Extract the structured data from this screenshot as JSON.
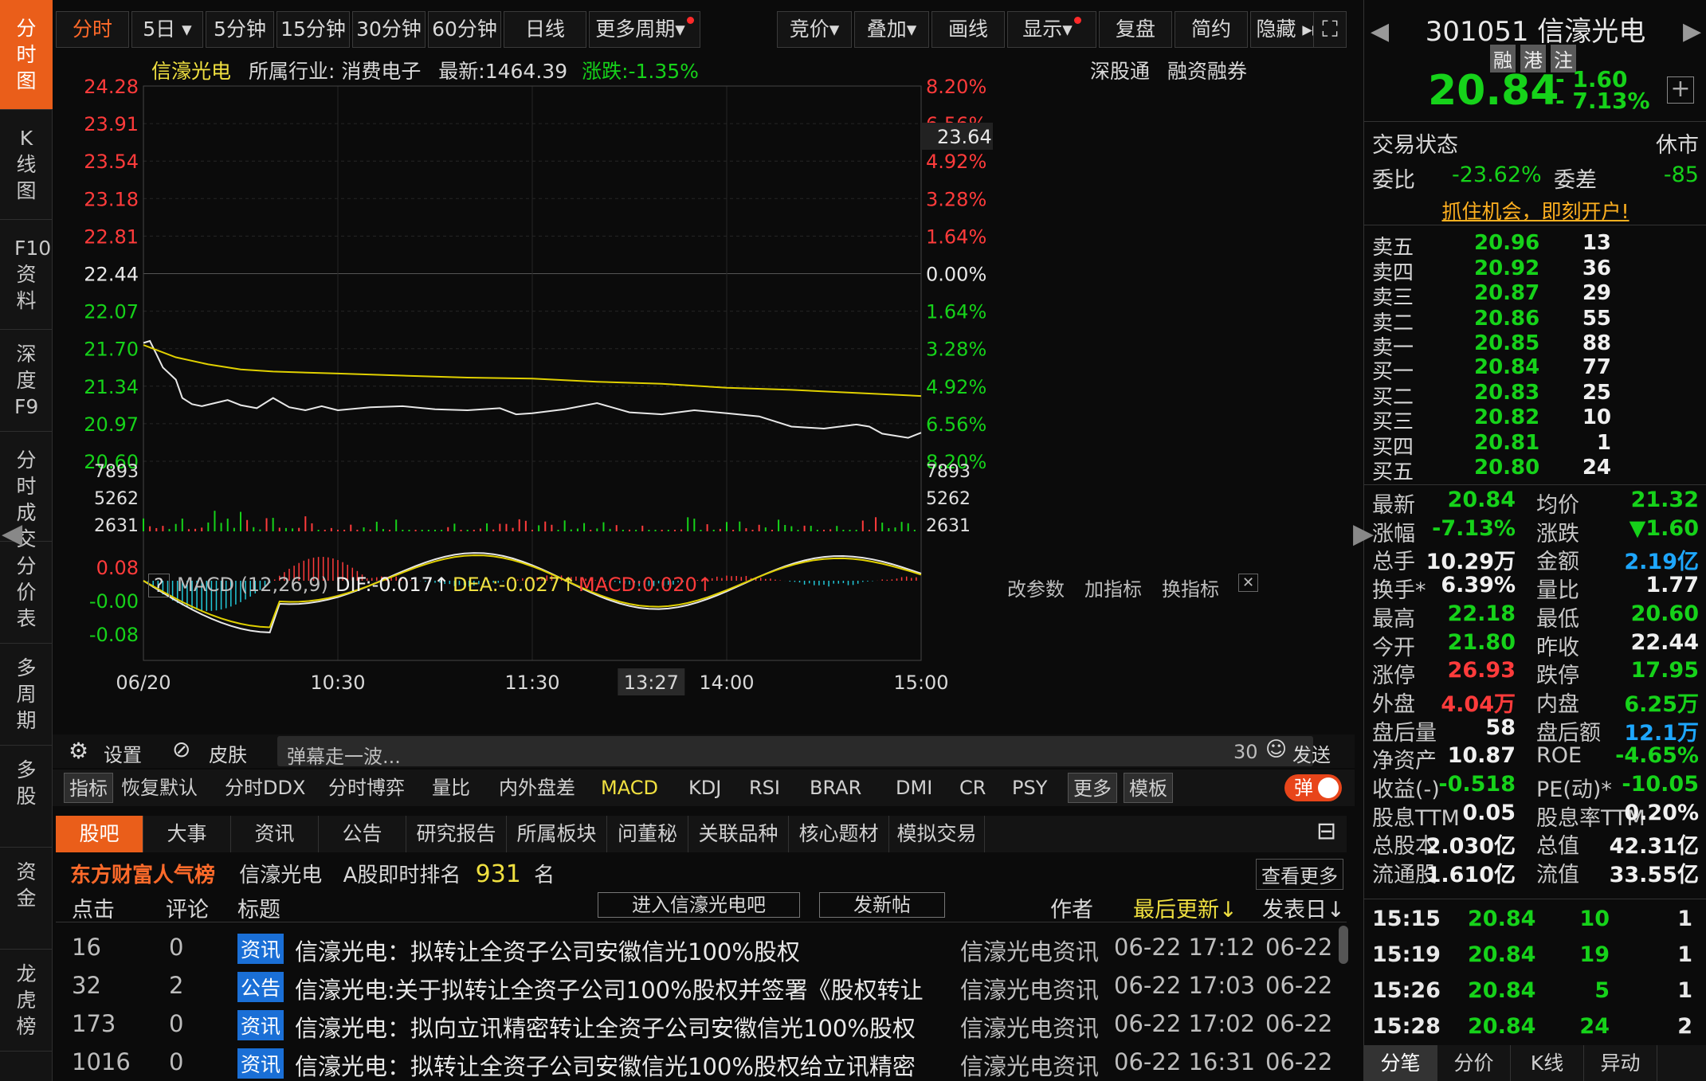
{
  "left_nav": [
    {
      "label": "分时图",
      "active": true
    },
    {
      "label": "K线图"
    },
    {
      "label": "F10资料"
    },
    {
      "label": "深度F9"
    },
    {
      "label": "分时成交"
    },
    {
      "label": "分价表"
    },
    {
      "label": "多周期"
    },
    {
      "label": "多股"
    },
    {
      "label": "资金"
    },
    {
      "label": "龙虎榜"
    }
  ],
  "toolbar": {
    "tabs": [
      "分时",
      "5日",
      "5分钟",
      "15分钟",
      "30分钟",
      "60分钟",
      "日线",
      "更多周期"
    ],
    "right": [
      "竞价",
      "叠加",
      "画线",
      "显示",
      "复盘",
      "简约",
      "隐藏 ▸▸"
    ]
  },
  "info": {
    "name": "信濠光电",
    "industry": "所属行业: 消费电子",
    "latest": "最新:1464.39",
    "change": "涨跌:-1.35%",
    "links": [
      "深股通",
      "融资融券"
    ]
  },
  "chart_data": {
    "type": "line",
    "title": "",
    "x_ticks": [
      "06/20",
      "10:30",
      "11:30",
      "13:27",
      "14:00",
      "15:00"
    ],
    "price_ticks_left": [
      "24.28",
      "23.91",
      "23.54",
      "23.18",
      "22.81",
      "22.44",
      "22.07",
      "21.70",
      "21.34",
      "20.97",
      "20.60"
    ],
    "pct_ticks_right": [
      "8.20%",
      "6.56%",
      "4.92%",
      "3.28%",
      "1.64%",
      "0.00%",
      "1.64%",
      "3.28%",
      "4.92%",
      "6.56%",
      "8.20%"
    ],
    "crosshair_value": "23.64",
    "ylim": [
      20.6,
      24.28
    ],
    "series": [
      {
        "color": "#e8e8e8",
        "x": [
          0,
          2,
          4,
          6,
          8,
          10,
          12,
          15,
          18,
          22,
          26,
          30,
          35,
          40,
          45,
          50,
          55,
          60,
          70,
          80,
          90,
          100,
          110,
          115,
          120,
          130,
          140,
          150,
          160,
          170,
          180,
          190,
          200,
          210,
          220,
          224,
          228,
          232,
          236,
          240
        ],
        "values": [
          21.76,
          21.78,
          21.65,
          21.52,
          21.46,
          21.4,
          21.22,
          21.16,
          21.14,
          21.17,
          21.2,
          21.15,
          21.12,
          21.22,
          21.13,
          21.1,
          21.14,
          21.1,
          21.13,
          21.14,
          21.11,
          21.1,
          21.12,
          21.06,
          21.07,
          21.11,
          21.17,
          21.08,
          21.06,
          21.1,
          21.07,
          21.04,
          20.94,
          20.92,
          20.96,
          20.94,
          20.87,
          20.85,
          20.83,
          20.88
        ]
      },
      {
        "color": "#e0d000",
        "x": [
          0,
          10,
          20,
          30,
          40,
          60,
          80,
          100,
          120,
          140,
          160,
          180,
          200,
          220,
          240
        ],
        "values": [
          21.74,
          21.62,
          21.55,
          21.5,
          21.48,
          21.46,
          21.44,
          21.42,
          21.41,
          21.38,
          21.36,
          21.32,
          21.3,
          21.27,
          21.24
        ]
      }
    ],
    "volume": {
      "ticks": [
        "7893",
        "5262",
        "2631"
      ]
    },
    "macd": {
      "label": "MACD (12,26,9)",
      "dif": "DIF:-0.017↑",
      "dea": "DEA:-0.027↑",
      "macd": "MACD:0.020↑",
      "ticks": [
        "0.08",
        "-0.00",
        "-0.08"
      ],
      "actions": [
        "改参数",
        "加指标",
        "换指标"
      ]
    }
  },
  "bar": {
    "settings": "设置",
    "skin": "皮肤",
    "placeholder": "弹幕走一波...",
    "count": "30",
    "send": "发送"
  },
  "ind_tabs": [
    "指标",
    "恢复默认",
    "分时DDX",
    "分时博弈",
    "量比",
    "内外盘差",
    "MACD",
    "KDJ",
    "RSI",
    "BRAR",
    "DMI",
    "CR",
    "PSY",
    "更多",
    "模板"
  ],
  "danmu": "弹",
  "news_tabs": [
    "股吧",
    "大事",
    "资讯",
    "公告",
    "研究报告",
    "所属板块",
    "问董秘",
    "关联品种",
    "核心题材",
    "模拟交易"
  ],
  "rank": {
    "brand": "东方财富人气榜",
    "name": "信濠光电",
    "rank_label": "A股即时排名",
    "rank": "931",
    "unit": "名",
    "more": "查看更多"
  },
  "news_head": {
    "clicks": "点击",
    "comments": "评论",
    "title": "标题",
    "enter": "进入信濠光电吧",
    "post": "发新帖",
    "author": "作者",
    "updated": "最后更新↓",
    "published": "发表日↓"
  },
  "news": [
    {
      "clicks": "16",
      "comments": "0",
      "tag": "资讯",
      "title": "信濠光电：拟转让全资子公司安徽信光100%股权",
      "author": "信濠光电资讯",
      "updated": "06-22 17:12",
      "pub": "06-22"
    },
    {
      "clicks": "32",
      "comments": "2",
      "tag": "公告",
      "title": "信濠光电:关于拟转让全资子公司100%股权并签署《股权转让",
      "author": "信濠光电资讯",
      "updated": "06-22 17:03",
      "pub": "06-22"
    },
    {
      "clicks": "173",
      "comments": "0",
      "tag": "资讯",
      "title": "信濠光电：拟向立讯精密转让全资子公司安徽信光100%股权",
      "author": "信濠光电资讯",
      "updated": "06-22 17:02",
      "pub": "06-22"
    },
    {
      "clicks": "1016",
      "comments": "0",
      "tag": "资讯",
      "title": "信濠光电：拟转让全资子公司安徽信光100%股权给立讯精密",
      "author": "信濠光电资讯",
      "updated": "06-22 16:31",
      "pub": "06-22"
    }
  ],
  "quote": {
    "code": "301051 信濠光电",
    "tags": [
      "融",
      "港",
      "注"
    ],
    "price": "20.84",
    "chg": "- 1.60",
    "pct": "- 7.13%",
    "status_label": "交易状态",
    "status": "休市",
    "wb_label": "委比",
    "wb": "-23.62%",
    "wc_label": "委差",
    "wc": "-85",
    "promo": "抓住机会，即刻开户!",
    "asks": [
      {
        "l": "卖五",
        "p": "20.96",
        "v": "13"
      },
      {
        "l": "卖四",
        "p": "20.92",
        "v": "36"
      },
      {
        "l": "卖三",
        "p": "20.87",
        "v": "29"
      },
      {
        "l": "卖二",
        "p": "20.86",
        "v": "55"
      },
      {
        "l": "卖一",
        "p": "20.85",
        "v": "88"
      }
    ],
    "bids": [
      {
        "l": "买一",
        "p": "20.84",
        "v": "77"
      },
      {
        "l": "买二",
        "p": "20.83",
        "v": "25"
      },
      {
        "l": "买三",
        "p": "20.82",
        "v": "10"
      },
      {
        "l": "买四",
        "p": "20.81",
        "v": "1"
      },
      {
        "l": "买五",
        "p": "20.80",
        "v": "24"
      }
    ],
    "stats": [
      [
        "最新",
        "20.84",
        "均价",
        "21.32"
      ],
      [
        "涨幅",
        "-7.13%",
        "涨跌",
        "▼1.60"
      ],
      [
        "总手",
        "10.29万",
        "金额",
        "2.19亿"
      ],
      [
        "换手*",
        "6.39%",
        "量比",
        "1.77"
      ],
      [
        "最高",
        "22.18",
        "最低",
        "20.60"
      ],
      [
        "今开",
        "21.80",
        "昨收",
        "22.44"
      ],
      [
        "涨停",
        "26.93",
        "跌停",
        "17.95"
      ],
      [
        "外盘",
        "4.04万",
        "内盘",
        "6.25万"
      ],
      [
        "盘后量",
        "58",
        "盘后额",
        "12.1万"
      ],
      [
        "净资产",
        "10.87",
        "ROE",
        "-4.65%"
      ],
      [
        "收益(-)",
        "-0.518",
        "PE(动)*",
        "-10.05"
      ],
      [
        "股息TTM",
        "0.05",
        "股息率TTM",
        "0.20%"
      ],
      [
        "总股本",
        "2.030亿",
        "总值",
        "42.31亿"
      ],
      [
        "流通股",
        "1.610亿",
        "流值",
        "33.55亿"
      ]
    ],
    "ticks": [
      {
        "t": "15:15",
        "p": "20.84",
        "v": "10",
        "n": "1"
      },
      {
        "t": "15:19",
        "p": "20.84",
        "v": "19",
        "n": "1"
      },
      {
        "t": "15:26",
        "p": "20.84",
        "v": "5",
        "n": "1"
      },
      {
        "t": "15:28",
        "p": "20.84",
        "v": "24",
        "n": "2"
      }
    ],
    "bottom_tabs": [
      "分笔",
      "分价",
      "K线",
      "异动"
    ]
  }
}
